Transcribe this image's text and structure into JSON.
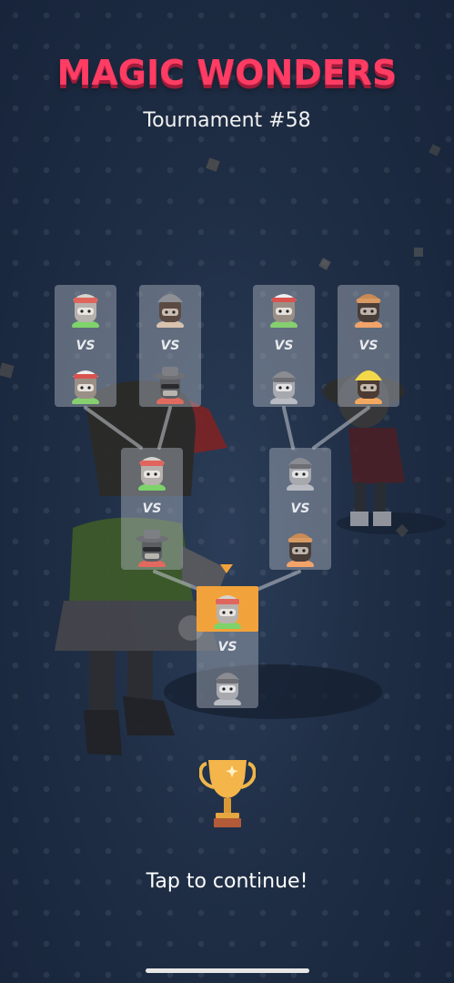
{
  "header": {
    "title": "MAGIC WONDERS",
    "subtitle": "Tournament #58"
  },
  "bracket": {
    "vs_label": "VS",
    "round1": [
      {
        "top": "green-cap-racer",
        "bottom": "green-cap-racer-2"
      },
      {
        "top": "grey-cap-racer",
        "bottom": "fedora-sunglasses-racer"
      },
      {
        "top": "white-cap-racer",
        "bottom": "grey-visor-racer"
      },
      {
        "top": "orange-beanie-racer",
        "bottom": "yellow-helmet-racer"
      }
    ],
    "round2": [
      {
        "top": "green-cap-racer",
        "bottom": "fedora-sunglasses-racer"
      },
      {
        "top": "grey-visor-racer",
        "bottom": "orange-beanie-racer"
      }
    ],
    "final": {
      "top": "green-cap-racer",
      "bottom": "grey-visor-racer",
      "highlighted": "top"
    }
  },
  "prize_icon": "trophy-icon",
  "footer": {
    "cta": "Tap to continue!"
  },
  "colors": {
    "title": "#ff3c63",
    "highlight": "#f2a23a",
    "background": "#1f2e45"
  }
}
